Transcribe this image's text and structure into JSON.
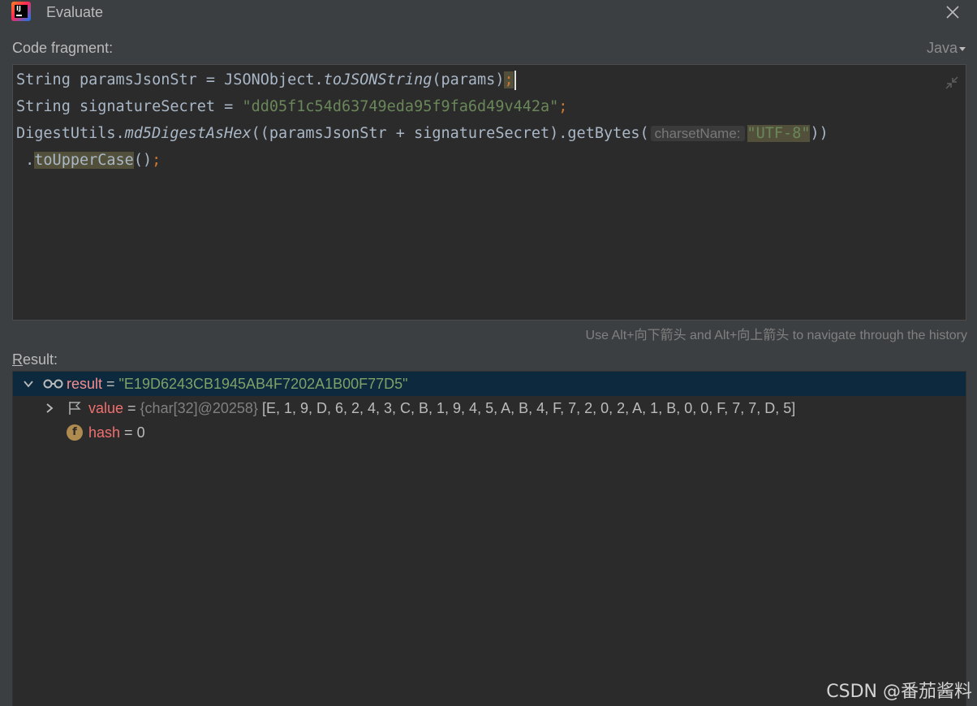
{
  "window": {
    "title": "Evaluate",
    "logo_text": "IJ"
  },
  "fragment": {
    "label": "Code fragment:",
    "language": "Java",
    "line1": {
      "a": "String paramsJsonStr = JSONObject.",
      "b": "toJSONString",
      "c": "(params)",
      "d": ";"
    },
    "line2": {
      "a": "String signatureSecret = ",
      "b": "\"dd05f1c54d63749eda95f9fa6d49v442a\"",
      "c": ";"
    },
    "line3": {
      "a": "DigestUtils.",
      "b": "md5DigestAsHex",
      "c": "((paramsJsonStr + signatureSecret).getBytes(",
      "hint": "charsetName:",
      "d": "\"UTF-8\"",
      "e": "))"
    },
    "line4": {
      "a": " .",
      "b": "toUpperCase",
      "c": "()",
      "d": ";"
    },
    "history_hint": "Use Alt+向下箭头 and Alt+向上箭头 to navigate through the history"
  },
  "result": {
    "label_first": "R",
    "label_rest": "esult:",
    "rows": [
      {
        "name": "result",
        "eq": " = ",
        "value": "\"E19D6243CB1945AB4F7202A1B00F77D5\""
      },
      {
        "name": "value",
        "eq": " = ",
        "type": "{char[32]@20258} ",
        "value": "[E, 1, 9, D, 6, 2, 4, 3, C, B, 1, 9, 4, 5, A, B, 4, F, 7, 2, 0, 2, A, 1, B, 0, 0, F, 7, 7, D, 5]"
      },
      {
        "name": "hash",
        "eq": " = ",
        "value": "0",
        "icon_letter": "f"
      }
    ]
  },
  "watermark": "CSDN @番茄酱料",
  "icons": [
    "intellij-logo-icon",
    "close-icon",
    "collapse-icon",
    "chevron-down-icon",
    "watch-glasses-icon",
    "chevron-right-icon",
    "flag-icon",
    "field-icon"
  ],
  "colors": {
    "background": "#3c3f41",
    "editor_bg": "#2b2b2b",
    "selection": "#0d293e",
    "string": "#6a8759",
    "keyword": "#cc7832",
    "var_name": "#f07070"
  }
}
